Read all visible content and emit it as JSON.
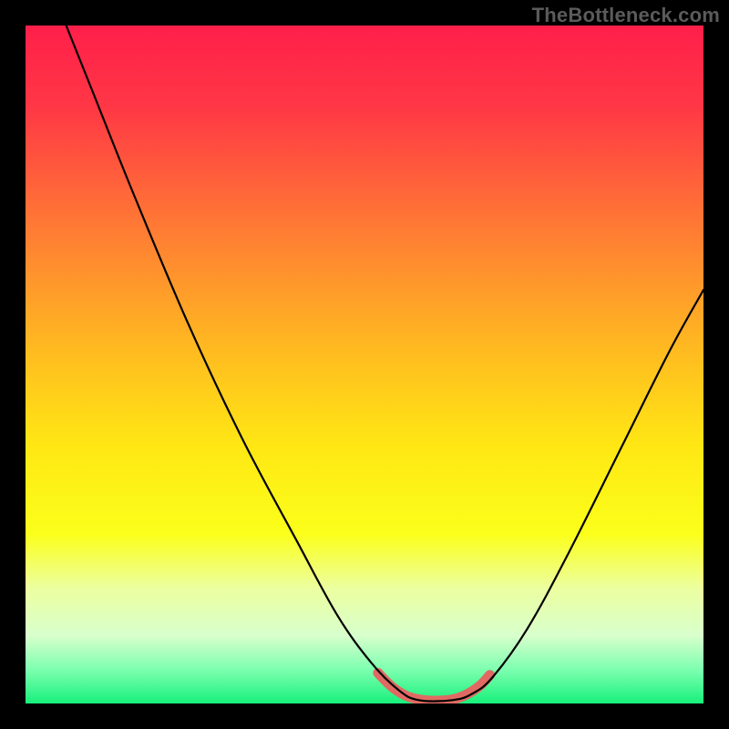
{
  "watermark": "TheBottleneck.com",
  "chart_data": {
    "type": "line",
    "title": "",
    "xlabel": "",
    "ylabel": "",
    "xlim": [
      0,
      100
    ],
    "ylim": [
      0,
      100
    ],
    "gradient_stops": [
      {
        "offset": 0.0,
        "color": "#ff1f4a"
      },
      {
        "offset": 0.12,
        "color": "#ff3745"
      },
      {
        "offset": 0.3,
        "color": "#ff7b34"
      },
      {
        "offset": 0.48,
        "color": "#ffbb20"
      },
      {
        "offset": 0.62,
        "color": "#ffe714"
      },
      {
        "offset": 0.75,
        "color": "#fbff1a"
      },
      {
        "offset": 0.83,
        "color": "#ecffa0"
      },
      {
        "offset": 0.9,
        "color": "#d8ffcc"
      },
      {
        "offset": 0.95,
        "color": "#7dffb0"
      },
      {
        "offset": 1.0,
        "color": "#17f07b"
      }
    ],
    "series": [
      {
        "name": "bottleneck-curve",
        "color": "#000000",
        "width": 2.2,
        "points": [
          {
            "x": 6.0,
            "y": 100.0
          },
          {
            "x": 10.0,
            "y": 90.0
          },
          {
            "x": 16.0,
            "y": 75.0
          },
          {
            "x": 24.0,
            "y": 56.0
          },
          {
            "x": 32.0,
            "y": 39.0
          },
          {
            "x": 40.0,
            "y": 24.0
          },
          {
            "x": 46.0,
            "y": 13.0
          },
          {
            "x": 51.0,
            "y": 6.0
          },
          {
            "x": 55.0,
            "y": 2.0
          },
          {
            "x": 58.0,
            "y": 0.5
          },
          {
            "x": 63.0,
            "y": 0.5
          },
          {
            "x": 66.0,
            "y": 1.5
          },
          {
            "x": 69.0,
            "y": 4.0
          },
          {
            "x": 74.0,
            "y": 11.0
          },
          {
            "x": 80.0,
            "y": 22.0
          },
          {
            "x": 88.0,
            "y": 38.0
          },
          {
            "x": 95.0,
            "y": 52.0
          },
          {
            "x": 100.0,
            "y": 61.0
          }
        ]
      },
      {
        "name": "trough-highlight",
        "color": "#e06a63",
        "width": 11,
        "points": [
          {
            "x": 52.0,
            "y": 4.5
          },
          {
            "x": 54.0,
            "y": 2.5
          },
          {
            "x": 56.0,
            "y": 1.2
          },
          {
            "x": 58.0,
            "y": 0.6
          },
          {
            "x": 60.5,
            "y": 0.4
          },
          {
            "x": 63.0,
            "y": 0.6
          },
          {
            "x": 65.0,
            "y": 1.3
          },
          {
            "x": 67.0,
            "y": 2.6
          },
          {
            "x": 68.5,
            "y": 4.2
          }
        ]
      }
    ]
  }
}
